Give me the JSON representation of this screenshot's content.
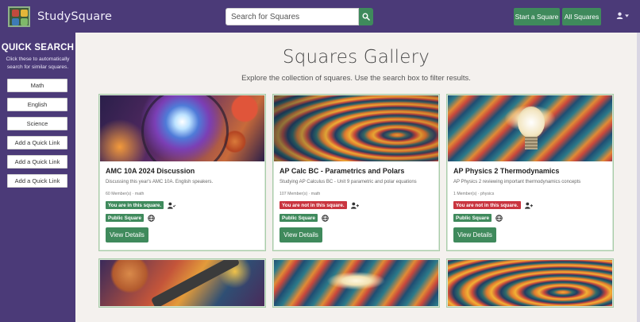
{
  "navbar": {
    "brand": "StudySquare",
    "search_placeholder": "Search for Squares",
    "start_square_label": "Start a Square",
    "all_squares_label": "All Squares"
  },
  "sidebar": {
    "title": "QUICK SEARCH",
    "subtitle": "Click these to automatically search for similar squares.",
    "links": [
      "Math",
      "English",
      "Science",
      "Add a Quick Link",
      "Add a Quick Link",
      "Add a Quick Link"
    ]
  },
  "main": {
    "title": "Squares Gallery",
    "subtitle": "Explore the collection of squares. Use the search box to filter results."
  },
  "cards": [
    {
      "title": "AMC 10A 2024 Discussion",
      "description": "Discussing this year's AMC 10A. English speakers.",
      "meta": "60 Member(s) · math",
      "membership": "You are in this square.",
      "membership_status": "in",
      "visibility": "Public Square",
      "button": "View Details"
    },
    {
      "title": "AP Calc BC - Parametrics and Polars",
      "description": "Studying AP Calculus BC - Unit 9 parametric and polar equations",
      "meta": "107 Member(s) · math",
      "membership": "You are not in this square.",
      "membership_status": "out",
      "visibility": "Public Square",
      "button": "View Details"
    },
    {
      "title": "AP Physics 2 Thermodynamics",
      "description": "AP Physics 2 reviewing important thermodynamics concepts",
      "meta": "1 Member(s) · physics",
      "membership": "You are not in this square.",
      "membership_status": "out",
      "visibility": "Public Square",
      "button": "View Details"
    }
  ],
  "colors": {
    "nav_purple": "#4b3a78",
    "accent_green": "#3f8a5c",
    "not_member_red": "#c9353f",
    "page_bg": "#f4f1ee"
  },
  "icons": {
    "search": "search-icon",
    "user": "user-icon",
    "join": "user-plus-icon",
    "globe": "globe-icon"
  }
}
